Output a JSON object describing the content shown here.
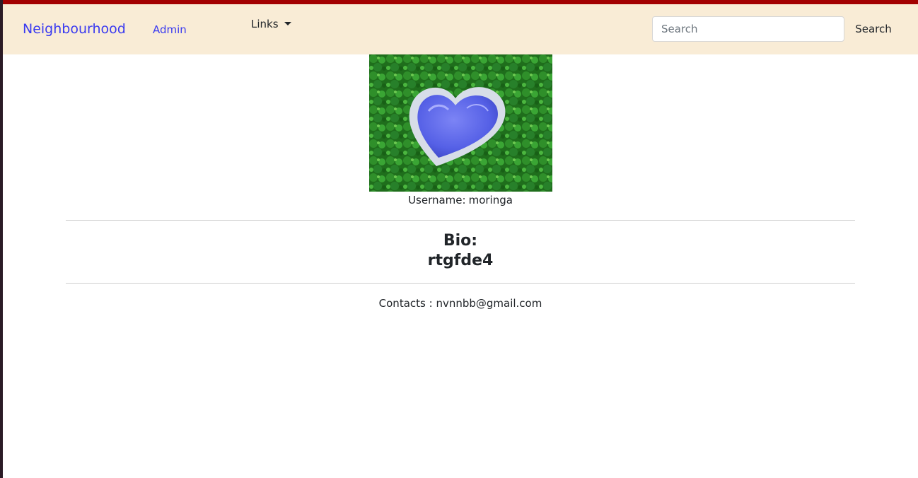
{
  "navbar": {
    "brand": "Neighbourhood",
    "admin_label": "Admin",
    "links_label": "Links",
    "search_placeholder": "Search",
    "search_button": "Search"
  },
  "profile": {
    "username_label": "Username:",
    "username": "moringa",
    "bio_label": "Bio:",
    "bio": "rtgfde4",
    "contacts_label": "Contacts :",
    "email": "nvnnbb@gmail.com"
  },
  "colors": {
    "top_strip": "#a30000",
    "navbar_bg": "#f9ecd6",
    "link": "#3a3af0"
  }
}
